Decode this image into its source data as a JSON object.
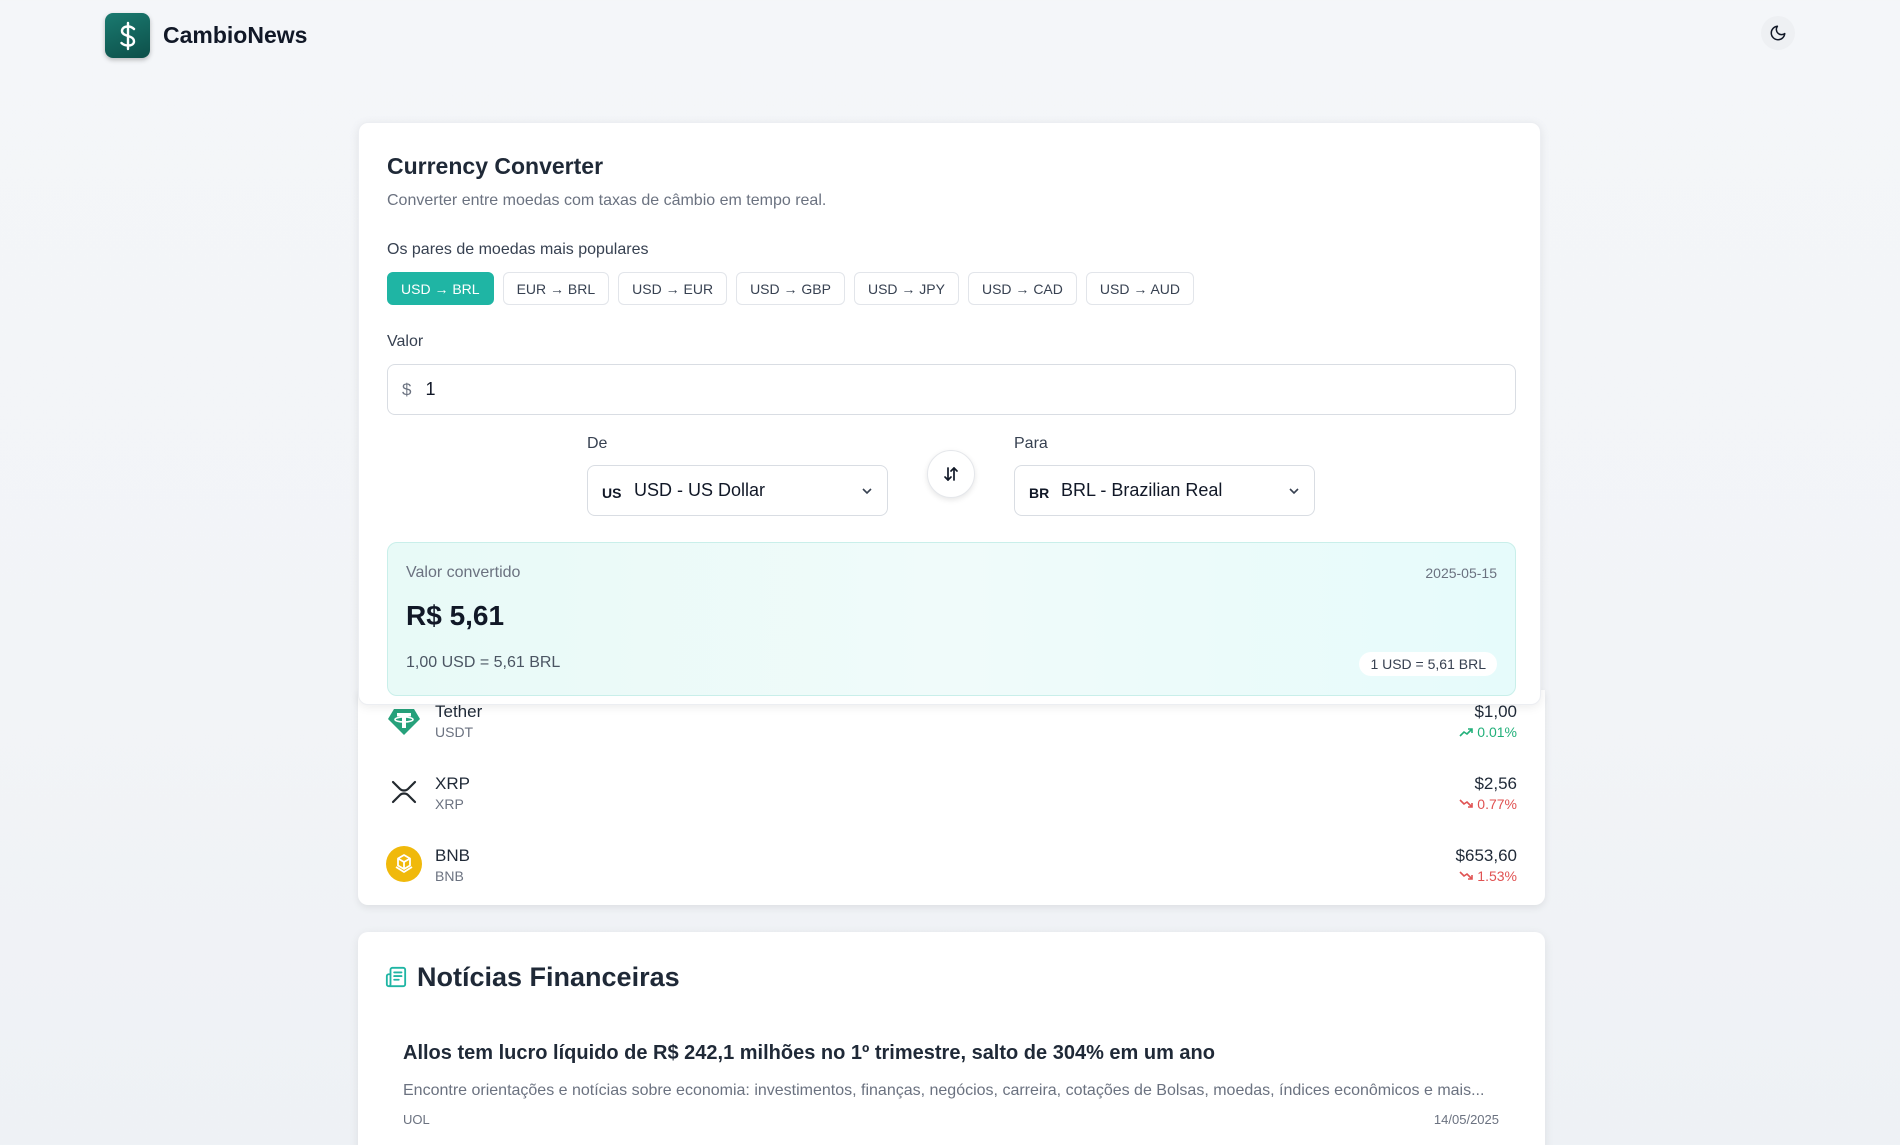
{
  "header": {
    "brand": "CambioNews",
    "theme_toggle_icon": "moon-icon"
  },
  "converter": {
    "title": "Currency Converter",
    "subtitle": "Converter entre moedas com taxas de câmbio em tempo real.",
    "pairs_label": "Os pares de moedas mais populares",
    "pairs": [
      "USD → BRL",
      "EUR → BRL",
      "USD → EUR",
      "USD → GBP",
      "USD → JPY",
      "USD → CAD",
      "USD → AUD"
    ],
    "active_pair": "USD → BRL",
    "valor_label": "Valor",
    "currency_symbol": "$",
    "amount": "1",
    "from_label": "De",
    "from_code": "US",
    "from_name": "USD - US Dollar",
    "to_label": "Para",
    "to_code": "BR",
    "to_name": "BRL - Brazilian Real",
    "result": {
      "label": "Valor convertido",
      "date": "2025-05-15",
      "amount": "R$ 5,61",
      "rate_text": "1,00 USD = 5,61 BRL",
      "rate_pill": "1 USD = 5,61 BRL"
    }
  },
  "crypto": [
    {
      "name": "Tether",
      "symbol": "USDT",
      "price": "$1,00",
      "change": "0.01%",
      "direction": "up",
      "icon": "tether-icon"
    },
    {
      "name": "XRP",
      "symbol": "XRP",
      "price": "$2,56",
      "change": "0.77%",
      "direction": "down",
      "icon": "xrp-icon"
    },
    {
      "name": "BNB",
      "symbol": "BNB",
      "price": "$653,60",
      "change": "1.53%",
      "direction": "down",
      "icon": "bnb-icon"
    }
  ],
  "news": {
    "title": "Notícias Financeiras",
    "articles": [
      {
        "headline": "Allos tem lucro líquido de R$ 242,1 milhões no 1º trimestre, salto de 304% em um ano",
        "excerpt": "Encontre orientações e notícias sobre economia: investimentos, finanças, negócios, carreira, cotações de Bolsas, moedas, índices econômicos e mais...",
        "source": "UOL",
        "date": "14/05/2025"
      }
    ]
  },
  "colors": {
    "accent": "#1fb5a4",
    "up": "#22b07a",
    "down": "#e05252"
  }
}
